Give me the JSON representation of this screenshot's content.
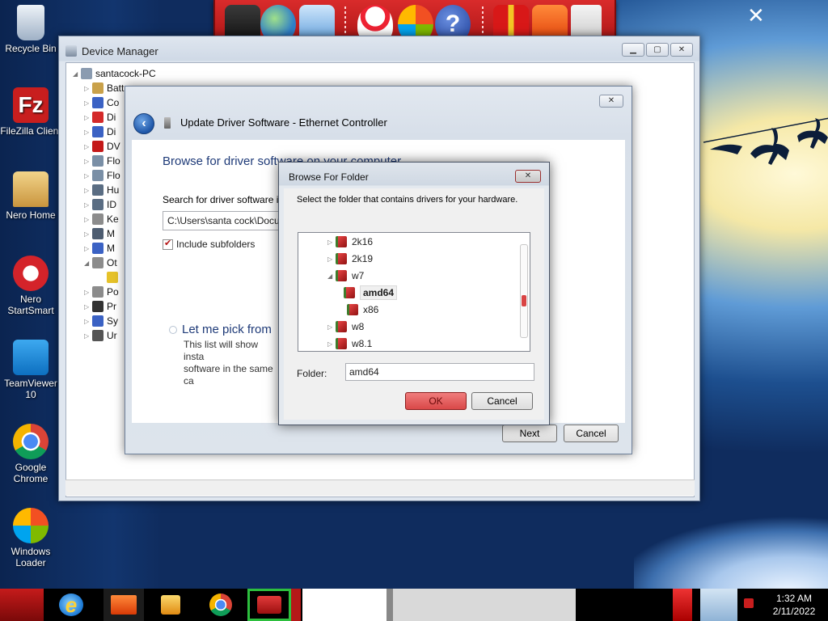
{
  "desktop": {
    "icons": [
      {
        "label": "Recycle Bin",
        "icon": "recycle-bin-icon"
      },
      {
        "label": "FileZilla Client",
        "icon": "filezilla-icon"
      },
      {
        "label": "Nero Home",
        "icon": "nero-home-icon"
      },
      {
        "label": "Nero StartSmart",
        "icon": "nero-startsmart-icon"
      },
      {
        "label": "TeamViewer 10",
        "icon": "teamviewer-icon"
      },
      {
        "label": "Google Chrome",
        "icon": "chrome-icon"
      },
      {
        "label": "Windows Loader",
        "icon": "windows-loader-icon"
      }
    ]
  },
  "toolbar": {
    "icons": [
      "monitor-icon",
      "globe-icon",
      "network-icon",
      "snowman-icon",
      "windows-logo-icon",
      "help-icon",
      "gift-icon",
      "folder-icon",
      "recycle-bin-icon"
    ]
  },
  "device_manager": {
    "title": "Device Manager",
    "root": "santacock-PC",
    "items": [
      "Batt",
      "Co",
      "Di",
      "Di",
      "DV",
      "Flo",
      "Flo",
      "Hu",
      "ID",
      "Ke",
      "M",
      "M",
      "Ot",
      "",
      "Po",
      "Pr",
      "Sy",
      "Ur"
    ]
  },
  "update_driver": {
    "title": "Update Driver Software - Ethernet Controller",
    "heading": "Browse for driver software on your computer",
    "search_label": "Search for driver software in",
    "path_value": "C:\\Users\\santa cock\\Docu",
    "include_subfolders": "Include subfolders",
    "pick_title": "Let me pick from",
    "pick_desc_line1": "This list will show insta",
    "pick_desc_line2": "software in the same ca",
    "next_label": "Next",
    "cancel_label": "Cancel"
  },
  "browse_folder": {
    "title": "Browse For Folder",
    "description": "Select the folder that contains drivers for your hardware.",
    "tree": [
      {
        "label": "2k16",
        "expanded": false
      },
      {
        "label": "2k19",
        "expanded": false
      },
      {
        "label": "w7",
        "expanded": true
      },
      {
        "label": "amd64",
        "selected": true
      },
      {
        "label": "x86"
      },
      {
        "label": "w8",
        "expanded": false
      },
      {
        "label": "w8.1",
        "expanded": false
      }
    ],
    "folder_label": "Folder:",
    "folder_value": "amd64",
    "ok_label": "OK",
    "cancel_label": "Cancel"
  },
  "taskbar": {
    "time": "1:32 AM",
    "date": "2/11/2022"
  },
  "colors": {
    "accent_red": "#d92b2b",
    "heading_blue": "#1e3a78"
  }
}
